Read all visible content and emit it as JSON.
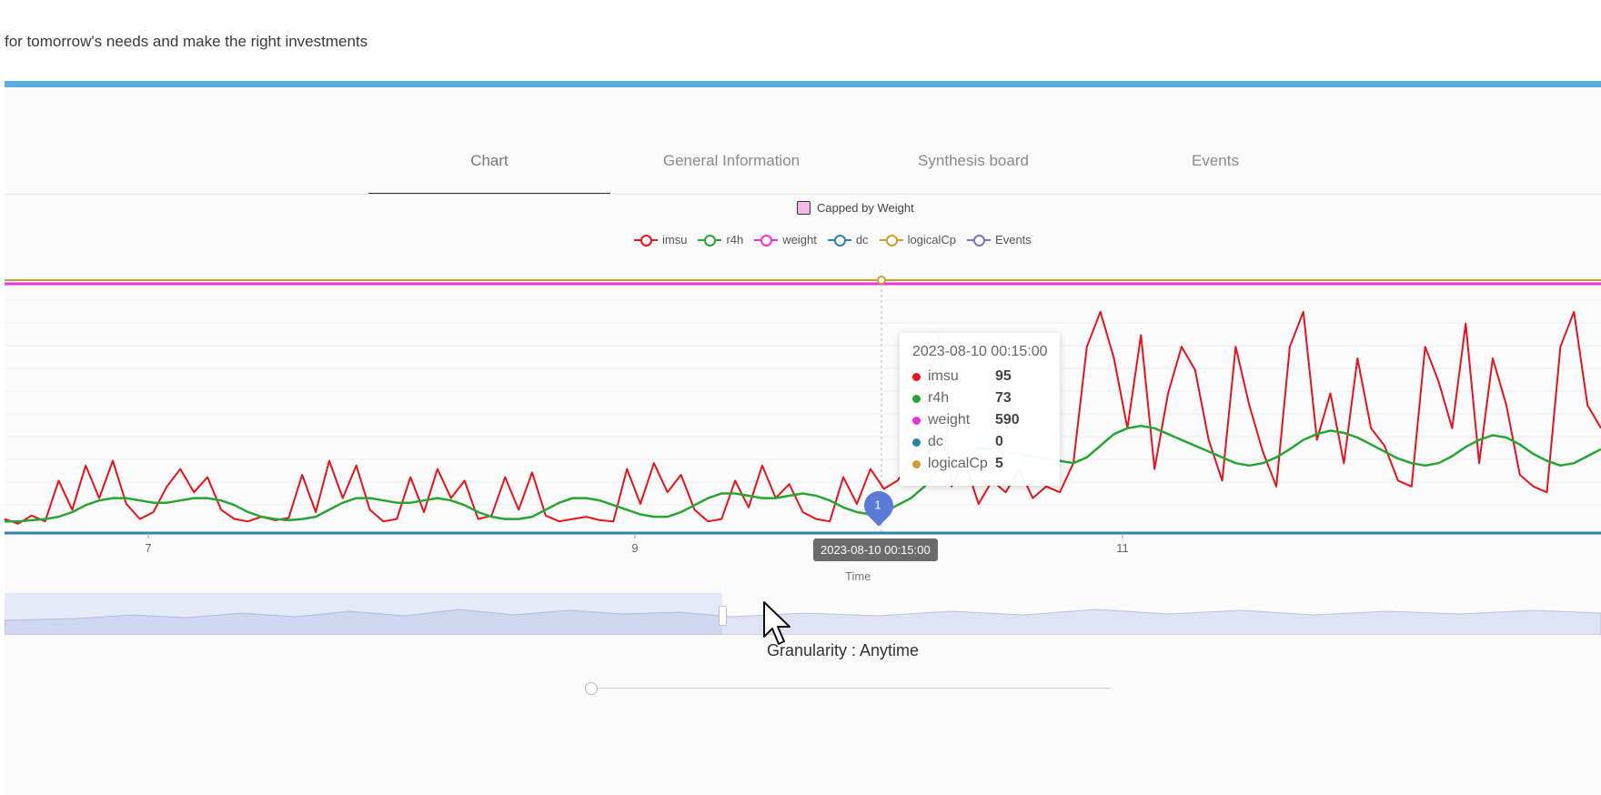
{
  "header": {
    "intro_text": "for tomorrow's needs and make the right investments"
  },
  "tabs": [
    {
      "label": "Chart",
      "active": true
    },
    {
      "label": "General Information",
      "active": false
    },
    {
      "label": "Synthesis board",
      "active": false
    },
    {
      "label": "Events",
      "active": false
    }
  ],
  "capped_legend": {
    "label": "Capped by Weight",
    "color": "#f3b8e6"
  },
  "legend": [
    {
      "label": "imsu",
      "color": "#e3141b"
    },
    {
      "label": "r4h",
      "color": "#27a532"
    },
    {
      "label": "weight",
      "color": "#e934dd"
    },
    {
      "label": "dc",
      "color": "#2c83b2"
    },
    {
      "label": "logicalCp",
      "color": "#cf9e2c"
    },
    {
      "label": "Events",
      "color": "#7b72c7"
    }
  ],
  "tooltip": {
    "title": "2023-08-10 00:15:00",
    "rows": [
      {
        "name": "imsu",
        "value": "95",
        "color": "#e3141b"
      },
      {
        "name": "r4h",
        "value": "73",
        "color": "#27a532"
      },
      {
        "name": "weight",
        "value": "590",
        "color": "#e934dd"
      },
      {
        "name": "dc",
        "value": "0",
        "color": "#2c83b2"
      },
      {
        "name": "logicalCp",
        "value": "5",
        "color": "#cf9e2c"
      }
    ]
  },
  "x_axis_badge": "2023-08-10 00:15:00",
  "event_marker": "1",
  "x_axis_title": "Time",
  "granularity": {
    "label": "Granularity : Anytime"
  },
  "chart_data": {
    "type": "line",
    "x_ticks": [
      "7",
      "9",
      "11"
    ],
    "xlabel": "Time",
    "series": [
      {
        "name": "imsu",
        "color": "#e3141b",
        "values": [
          12,
          8,
          15,
          10,
          45,
          20,
          58,
          30,
          62,
          25,
          12,
          18,
          40,
          55,
          35,
          48,
          20,
          12,
          10,
          14,
          11,
          13,
          50,
          18,
          62,
          30,
          58,
          20,
          10,
          12,
          48,
          18,
          55,
          30,
          45,
          12,
          15,
          48,
          20,
          52,
          15,
          10,
          12,
          14,
          11,
          10,
          55,
          25,
          60,
          35,
          50,
          20,
          10,
          12,
          45,
          22,
          58,
          30,
          42,
          18,
          12,
          10,
          48,
          25,
          55,
          38,
          45,
          62,
          95,
          170,
          40,
          60,
          25,
          45,
          35,
          55,
          30,
          40,
          35,
          60,
          160,
          190,
          150,
          90,
          170,
          55,
          120,
          160,
          140,
          80,
          45,
          160,
          110,
          70,
          40,
          160,
          190,
          80,
          120,
          60,
          150,
          90,
          75,
          45,
          40,
          160,
          130,
          90,
          180,
          60,
          150,
          110,
          50,
          40,
          35,
          160,
          190,
          110,
          90
        ]
      },
      {
        "name": "r4h",
        "color": "#27a532",
        "values": [
          10,
          10,
          11,
          12,
          14,
          18,
          24,
          28,
          30,
          30,
          28,
          26,
          26,
          28,
          30,
          30,
          28,
          24,
          18,
          14,
          12,
          11,
          12,
          14,
          20,
          26,
          30,
          30,
          28,
          26,
          26,
          28,
          30,
          28,
          24,
          18,
          14,
          12,
          12,
          14,
          20,
          26,
          30,
          30,
          28,
          24,
          20,
          16,
          14,
          14,
          18,
          24,
          30,
          34,
          34,
          32,
          30,
          30,
          32,
          34,
          32,
          28,
          22,
          18,
          16,
          18,
          24,
          30,
          40,
          55,
          60,
          70,
          73,
          72,
          70,
          68,
          66,
          64,
          62,
          60,
          65,
          75,
          85,
          90,
          92,
          90,
          85,
          80,
          75,
          70,
          65,
          60,
          58,
          60,
          65,
          72,
          80,
          85,
          88,
          86,
          82,
          76,
          70,
          64,
          60,
          58,
          60,
          66,
          74,
          80,
          84,
          82,
          76,
          68,
          62,
          58,
          60,
          66,
          72
        ]
      },
      {
        "name": "weight",
        "color": "#e934dd",
        "values": [
          590
        ]
      },
      {
        "name": "logicalCp",
        "color": "#cf9e2c",
        "values": [
          5
        ]
      },
      {
        "name": "dc",
        "color": "#2c83b2",
        "values": [
          0
        ]
      }
    ]
  }
}
